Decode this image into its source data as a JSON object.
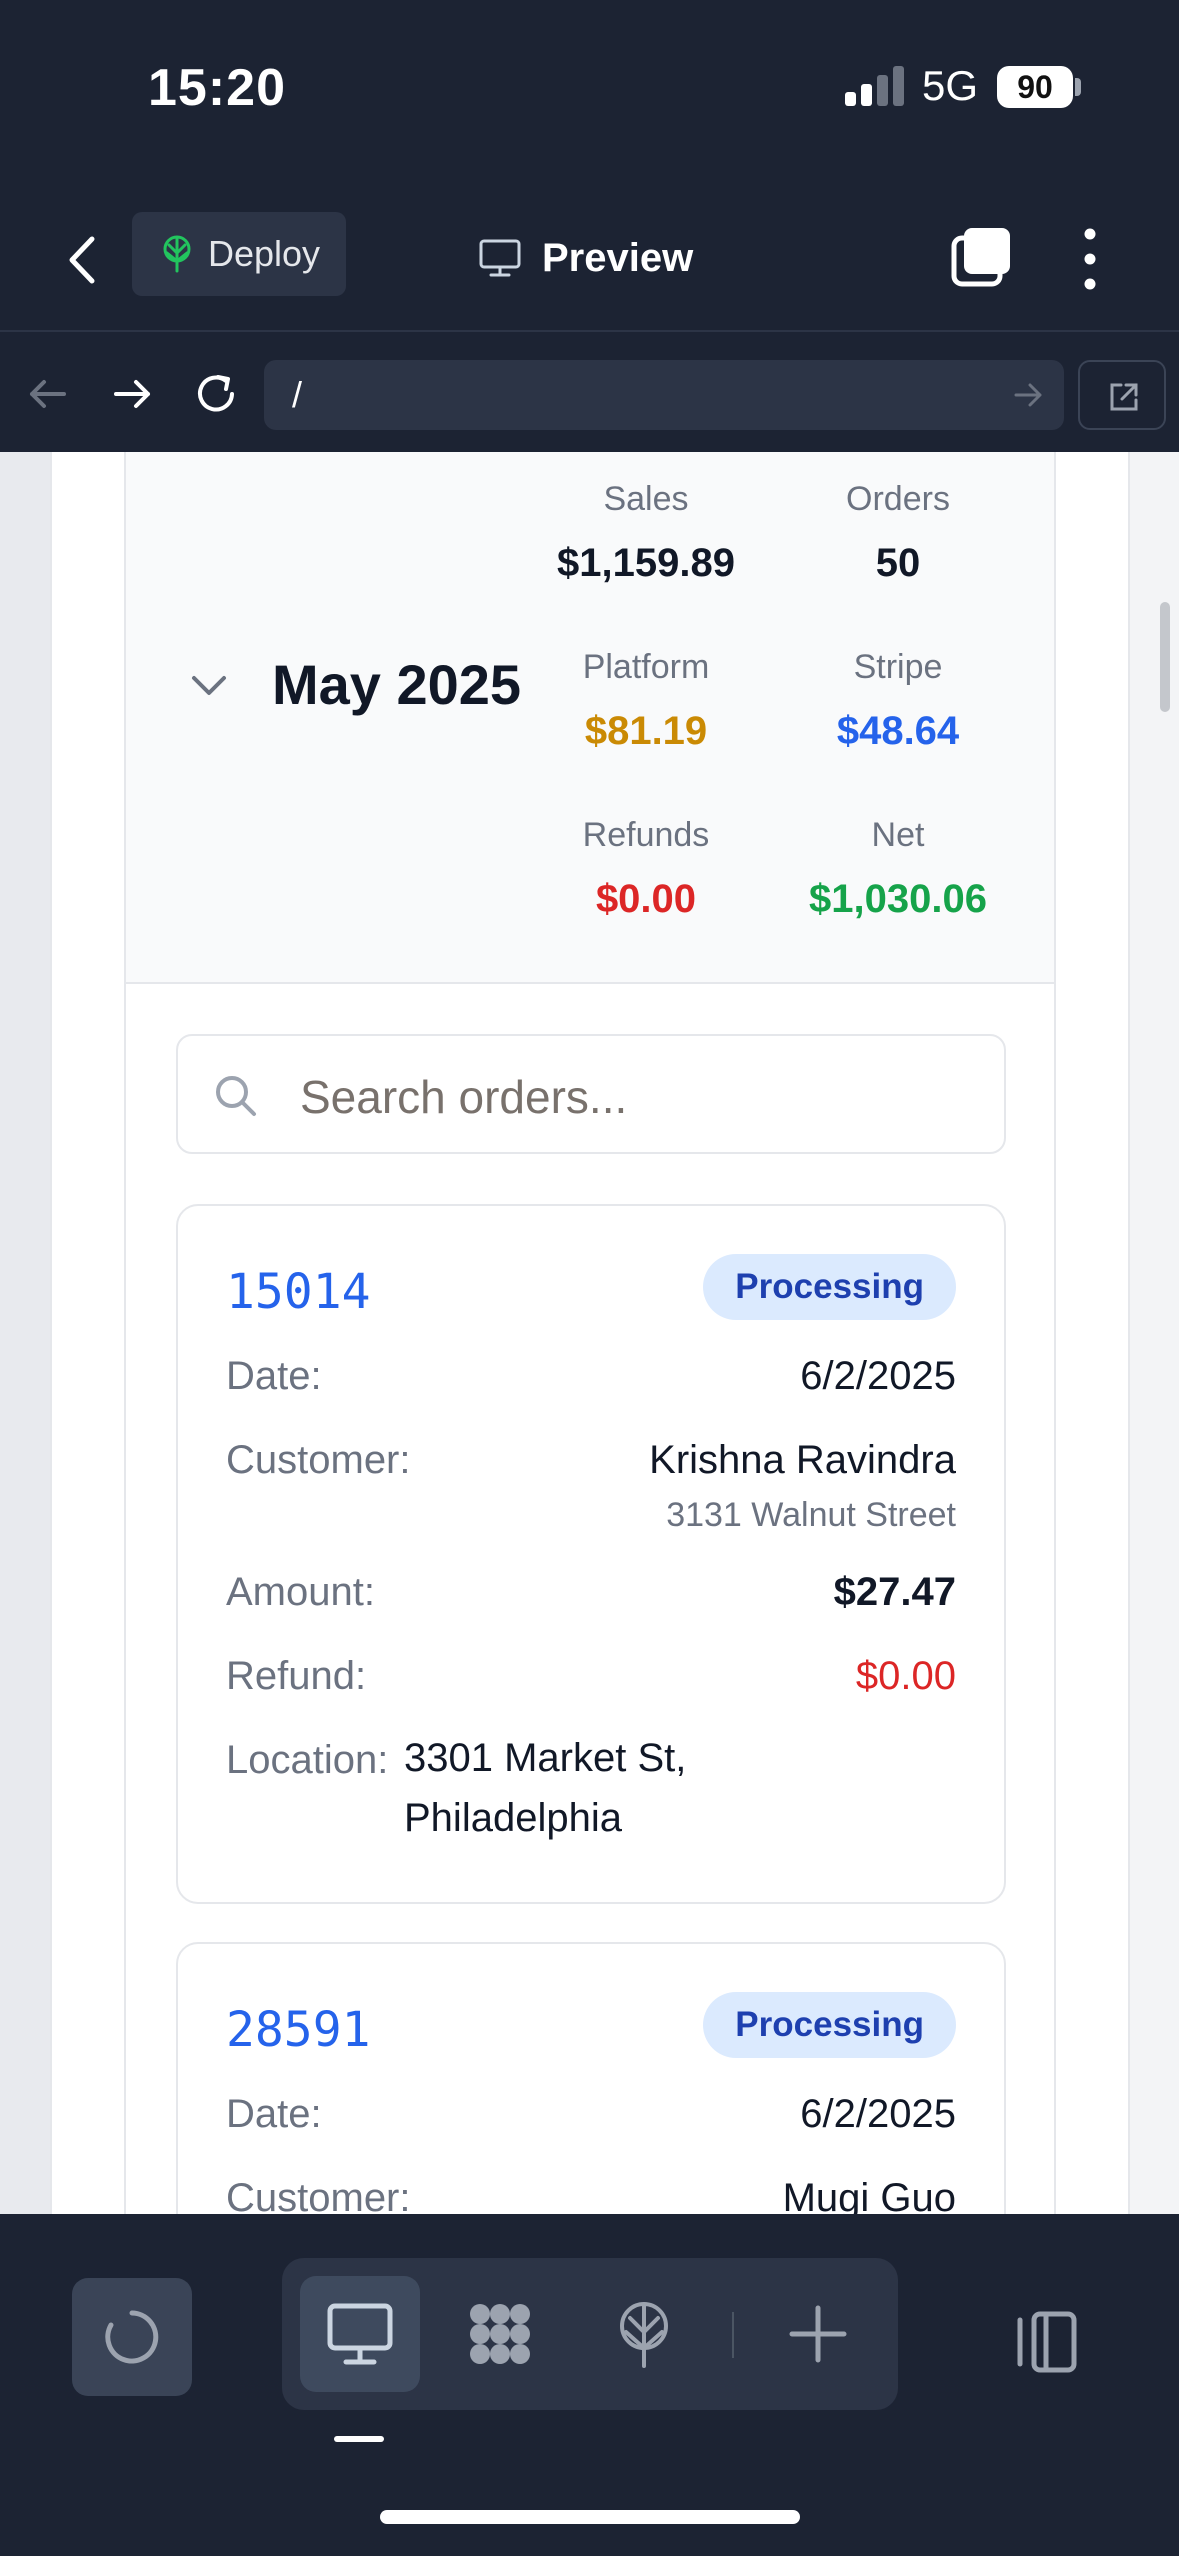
{
  "status_bar": {
    "time": "15:20",
    "network": "5G",
    "battery": "90"
  },
  "header": {
    "deploy_label": "Deploy",
    "preview_label": "Preview"
  },
  "url_bar": {
    "url": "/"
  },
  "summary": {
    "month": "May 2025",
    "stats": {
      "sales": {
        "label": "Sales",
        "value": "$1,159.89",
        "color": "#111827"
      },
      "orders": {
        "label": "Orders",
        "value": "50",
        "color": "#111827"
      },
      "platform": {
        "label": "Platform",
        "value": "$81.19",
        "color": "#ca8a04"
      },
      "stripe": {
        "label": "Stripe",
        "value": "$48.64",
        "color": "#2563eb"
      },
      "refunds": {
        "label": "Refunds",
        "value": "$0.00",
        "color": "#dc2626"
      },
      "net": {
        "label": "Net",
        "value": "$1,030.06",
        "color": "#16a34a"
      }
    }
  },
  "search": {
    "placeholder": "Search orders..."
  },
  "labels": {
    "date": "Date:",
    "customer": "Customer:",
    "amount": "Amount:",
    "refund": "Refund:",
    "location": "Location:"
  },
  "orders": [
    {
      "id": "15014",
      "status": "Processing",
      "date": "6/2/2025",
      "customer": "Krishna Ravindra",
      "customer_address": "3131 Walnut Street",
      "amount": "$27.47",
      "refund": "$0.00",
      "location_line1": "3301 Market St,",
      "location_line2": "Philadelphia"
    },
    {
      "id": "28591",
      "status": "Processing",
      "date": "6/2/2025",
      "customer": "Mugi Guo"
    }
  ],
  "icons": {
    "back": "chevron-left-icon",
    "deploy": "deploy-tree-icon",
    "preview": "monitor-icon",
    "tabs": "tabs-icon",
    "more": "more-vertical-icon",
    "nav_back": "arrow-left-icon",
    "nav_forward": "arrow-right-icon",
    "reload": "reload-icon",
    "open_external": "external-link-icon",
    "search": "search-icon"
  },
  "colors": {
    "accent": "#2563eb",
    "badge_bg": "#dbeafe",
    "dark_bg": "#1c2333"
  }
}
